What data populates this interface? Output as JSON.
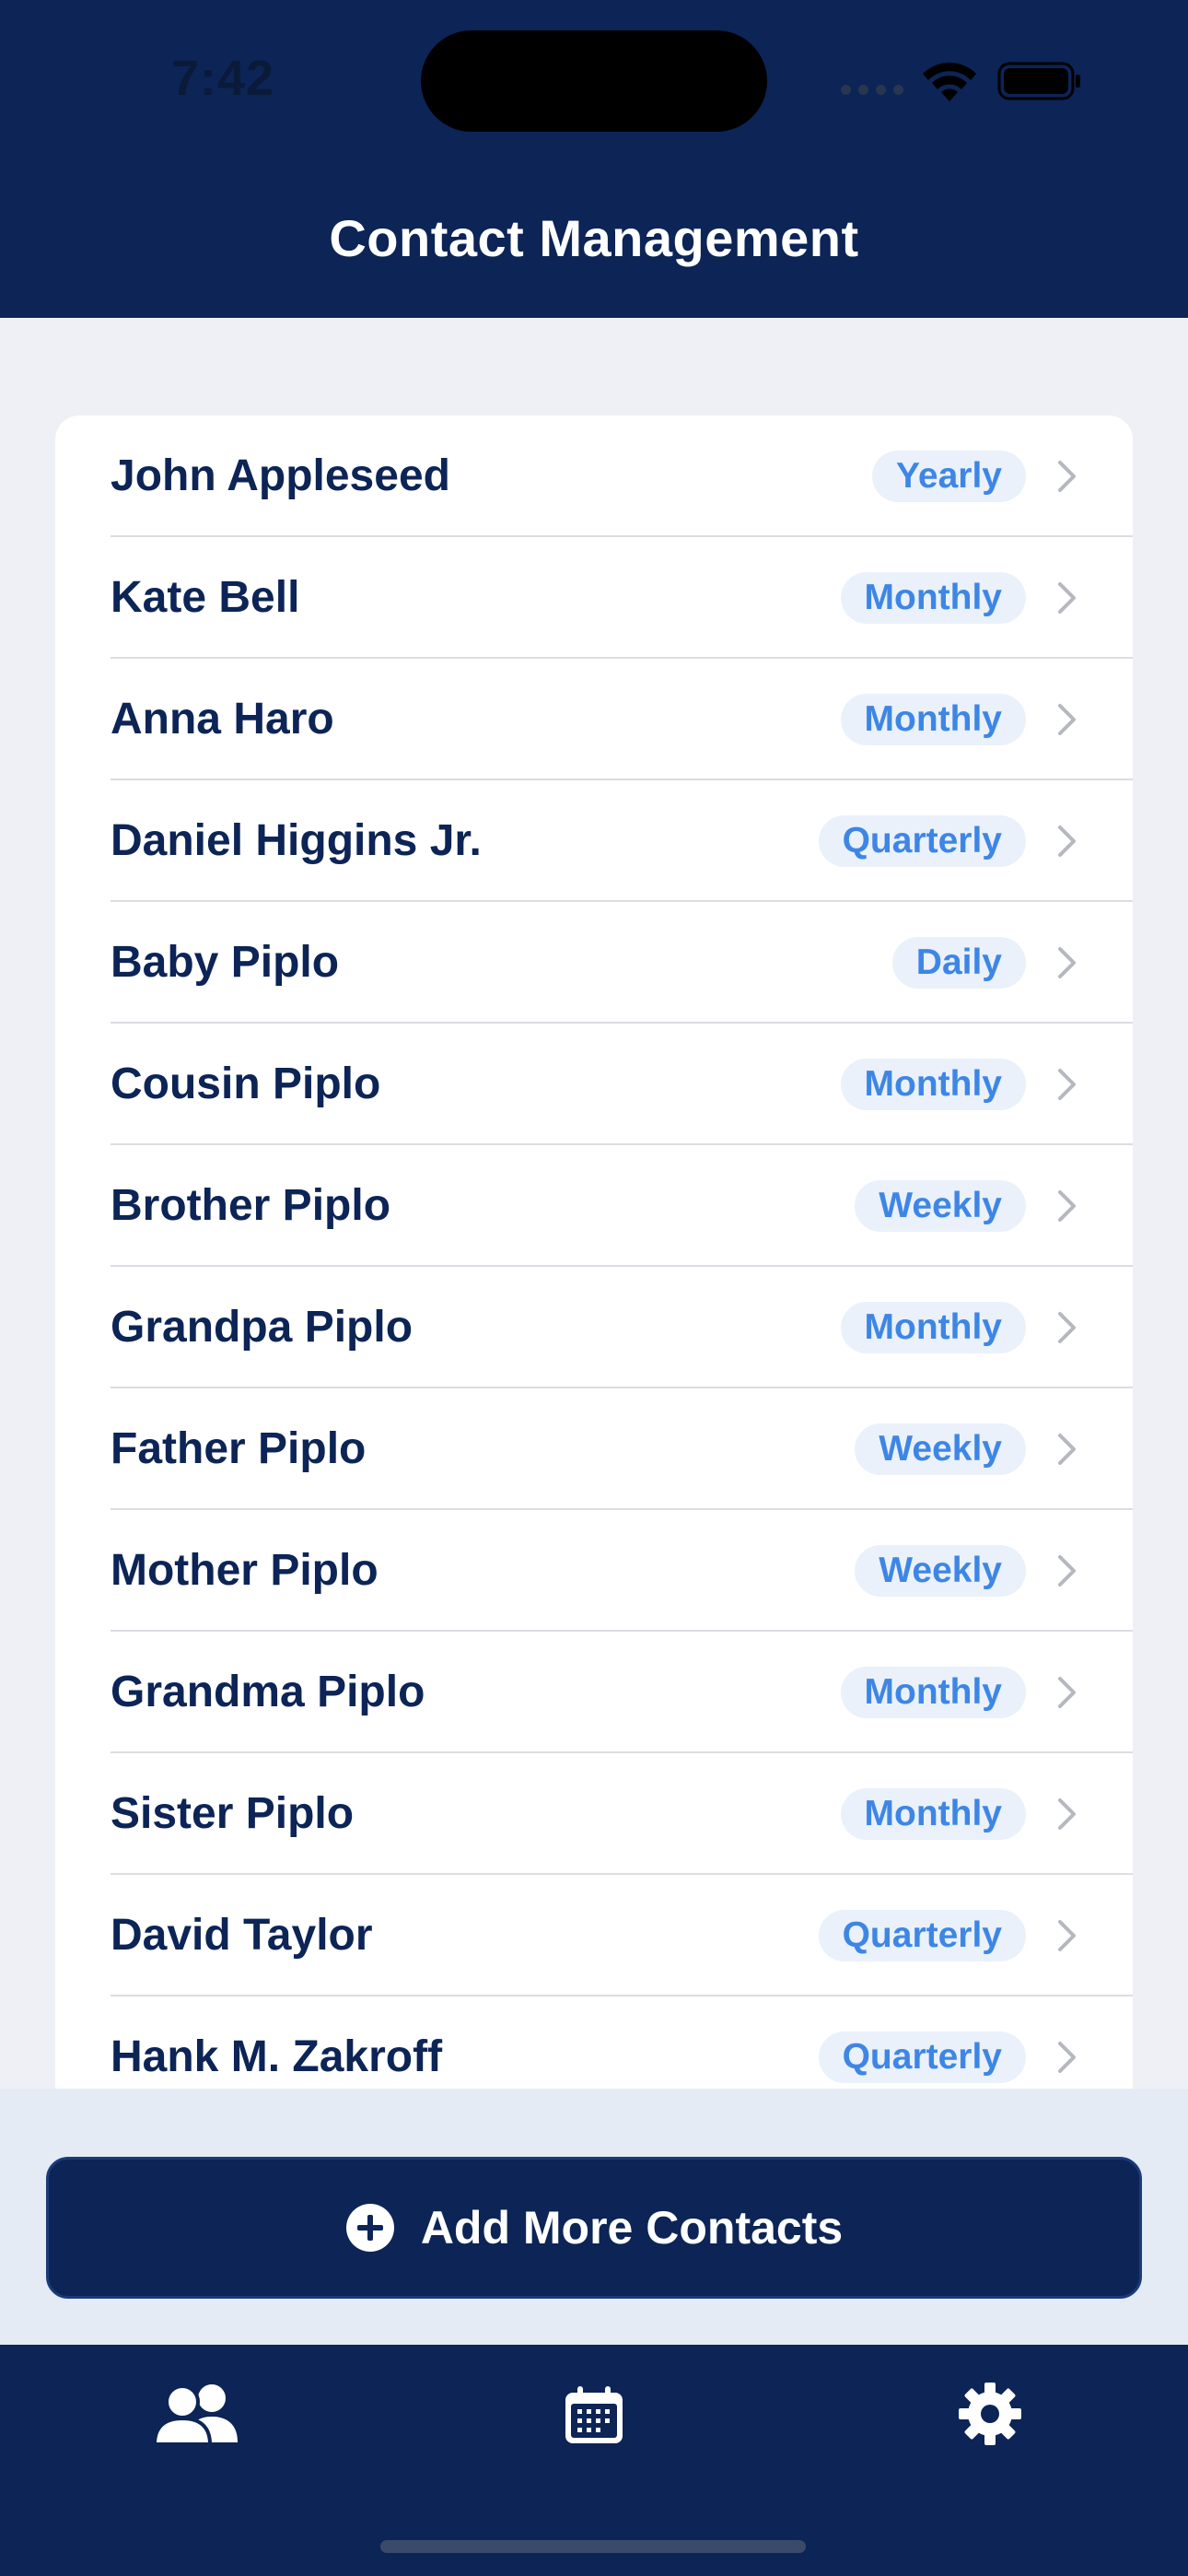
{
  "status_bar": {
    "time": "7:42"
  },
  "header": {
    "title": "Contact Management"
  },
  "contacts": [
    {
      "name": "John Appleseed",
      "frequency": "Yearly"
    },
    {
      "name": "Kate Bell",
      "frequency": "Monthly"
    },
    {
      "name": "Anna Haro",
      "frequency": "Monthly"
    },
    {
      "name": "Daniel Higgins Jr.",
      "frequency": "Quarterly"
    },
    {
      "name": "Baby Piplo",
      "frequency": "Daily"
    },
    {
      "name": "Cousin Piplo",
      "frequency": "Monthly"
    },
    {
      "name": "Brother Piplo",
      "frequency": "Weekly"
    },
    {
      "name": "Grandpa Piplo",
      "frequency": "Monthly"
    },
    {
      "name": "Father Piplo",
      "frequency": "Weekly"
    },
    {
      "name": "Mother Piplo",
      "frequency": "Weekly"
    },
    {
      "name": "Grandma Piplo",
      "frequency": "Monthly"
    },
    {
      "name": "Sister Piplo",
      "frequency": "Monthly"
    },
    {
      "name": "David Taylor",
      "frequency": "Quarterly"
    },
    {
      "name": "Hank M. Zakroff",
      "frequency": "Quarterly"
    }
  ],
  "add_button": {
    "label": "Add More Contacts",
    "icon": "plus-circle-icon"
  },
  "tab_bar": {
    "tabs": [
      {
        "icon": "people-icon"
      },
      {
        "icon": "calendar-icon"
      },
      {
        "icon": "gear-icon"
      }
    ]
  },
  "colors": {
    "navy": "#0c2456",
    "badge_text": "#3e86e5",
    "badge_bg": "#eaf1fb",
    "background": "#eff0f5"
  }
}
